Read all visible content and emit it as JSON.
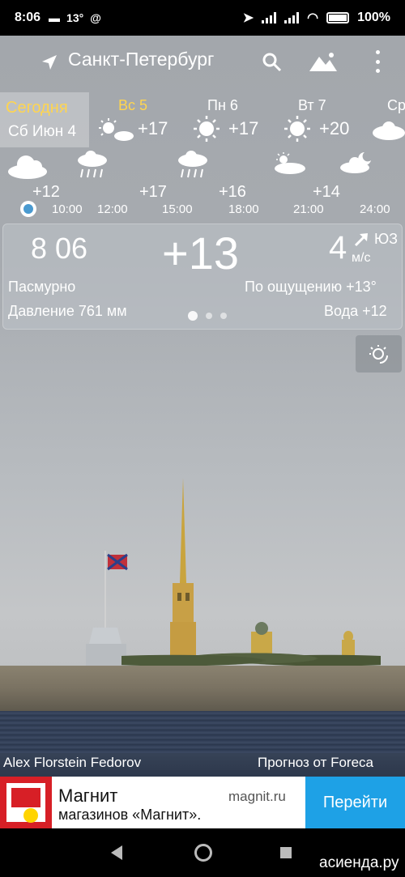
{
  "status_bar": {
    "time": "8:06",
    "notif_temp": "13°",
    "battery": "100%"
  },
  "toolbar": {
    "city": "Санкт-Петербург",
    "icons": [
      "navigation-arrow-icon",
      "search-icon",
      "landscape-icon",
      "more-vert-icon"
    ]
  },
  "days": [
    {
      "label": "Сегодня",
      "date": "Сб Июн 4"
    },
    {
      "label": "Вс 5",
      "temp": "+17",
      "icon": "partly-cloudy-icon"
    },
    {
      "label": "Пн 6",
      "temp": "+17",
      "icon": "sun-icon"
    },
    {
      "label": "Вт 7",
      "temp": "+20",
      "icon": "sun-icon"
    },
    {
      "label": "Ср",
      "icon": "cloud-icon"
    }
  ],
  "hourly": {
    "temps": [
      "+12",
      "+17",
      "+16",
      "+14"
    ],
    "times": [
      "10:00",
      "12:00",
      "15:00",
      "18:00",
      "21:00",
      "24:00"
    ]
  },
  "current": {
    "time": "8 06",
    "temp": "+13",
    "wind_speed": "4",
    "wind_dir": "ЮЗ",
    "wind_unit": "м/с",
    "condition": "Пасмурно",
    "feels_like": "По ощущению +13°",
    "pressure": "Давление 761 мм",
    "water": "Вода +12",
    "page_indicator": {
      "current": 1,
      "total": 3
    }
  },
  "photo_credit": "Alex Florstein Fedorov",
  "forecast_source": "Прогноз от Foreca",
  "ad": {
    "title": "Магнит",
    "subtitle": "магазинов «Магнит».",
    "domain": "magnit.ru",
    "button": "Перейти"
  },
  "watermark": "асиенда.ру",
  "colors": {
    "today_highlight": "#ffd54f",
    "ad_button": "#1ea1e6",
    "timeline_dot": "#4a9ad0"
  }
}
